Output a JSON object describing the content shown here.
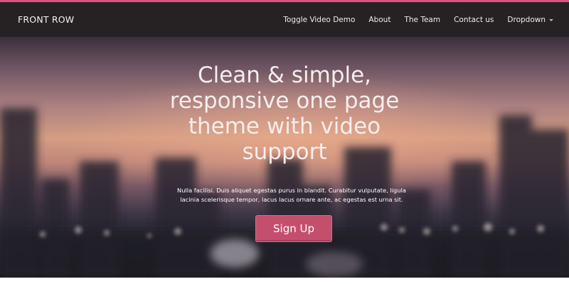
{
  "brand": "FRONT ROW",
  "nav": {
    "items": [
      {
        "label": "Toggle Video Demo"
      },
      {
        "label": "About"
      },
      {
        "label": "The Team"
      },
      {
        "label": "Contact us"
      },
      {
        "label": "Dropdown"
      }
    ]
  },
  "hero": {
    "title_lines": [
      "Clean & simple,",
      "responsive one page",
      "theme with video",
      "support"
    ],
    "text_lines": [
      "Nulla facilisi. Duis aliquet egestas purus in blandit. Curabitur vulputate, ligula",
      "lacinia scelerisque tempor, lacus lacus ornare ante, ac egestas est urna sit."
    ],
    "cta_label": "Sign Up"
  },
  "colors": {
    "accent": "#d9537c",
    "navbar": "#262223",
    "cta": "#c44f6c"
  },
  "icons": {
    "dropdown_caret": "caret-down-icon"
  }
}
